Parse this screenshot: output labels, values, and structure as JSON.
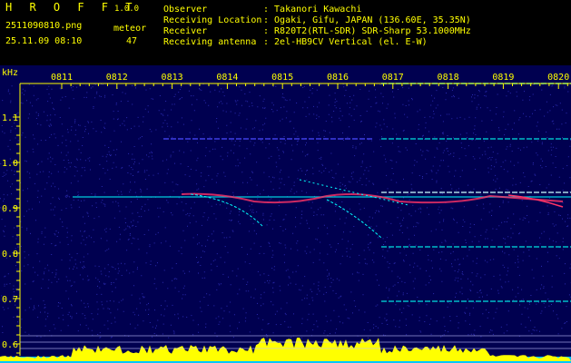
{
  "header": {
    "app_title": "H R O F F T",
    "version": "1.0.0",
    "filename": "2511090810.png",
    "meteor_label": "meteor",
    "datetime": "25.11.09 08:10",
    "meteor_count": "47",
    "info": [
      {
        "key": "Observer",
        "value": ": Takanori Kawachi"
      },
      {
        "key": "Receiving Location",
        "value": ": Ogaki, Gifu, JAPAN (136.60E, 35.35N)"
      },
      {
        "key": "Receiver",
        "value": ": R820T2(RTL-SDR) SDR-Sharp 53.1000MHz"
      },
      {
        "key": "Receiving antenna",
        "value": ": 2el-HB9CV Vertical (el. E-W)"
      }
    ]
  },
  "plot": {
    "y_unit": "kHz",
    "y_ticks": [
      "1.1",
      "1.0",
      "0.9",
      "0.8",
      "0.7",
      "0.6"
    ],
    "x_ticks": [
      "0811",
      "0812",
      "0813",
      "0814",
      "0815",
      "0816",
      "0817",
      "0818",
      "0819",
      "0820"
    ],
    "colors": {
      "background": "#000050",
      "noise": "#3a3ad0",
      "label": "#ffff00",
      "trail": "#00ffff",
      "hot": "#ff3366",
      "histogram": "#ffff00",
      "baseline": "#00c8ff"
    }
  }
}
